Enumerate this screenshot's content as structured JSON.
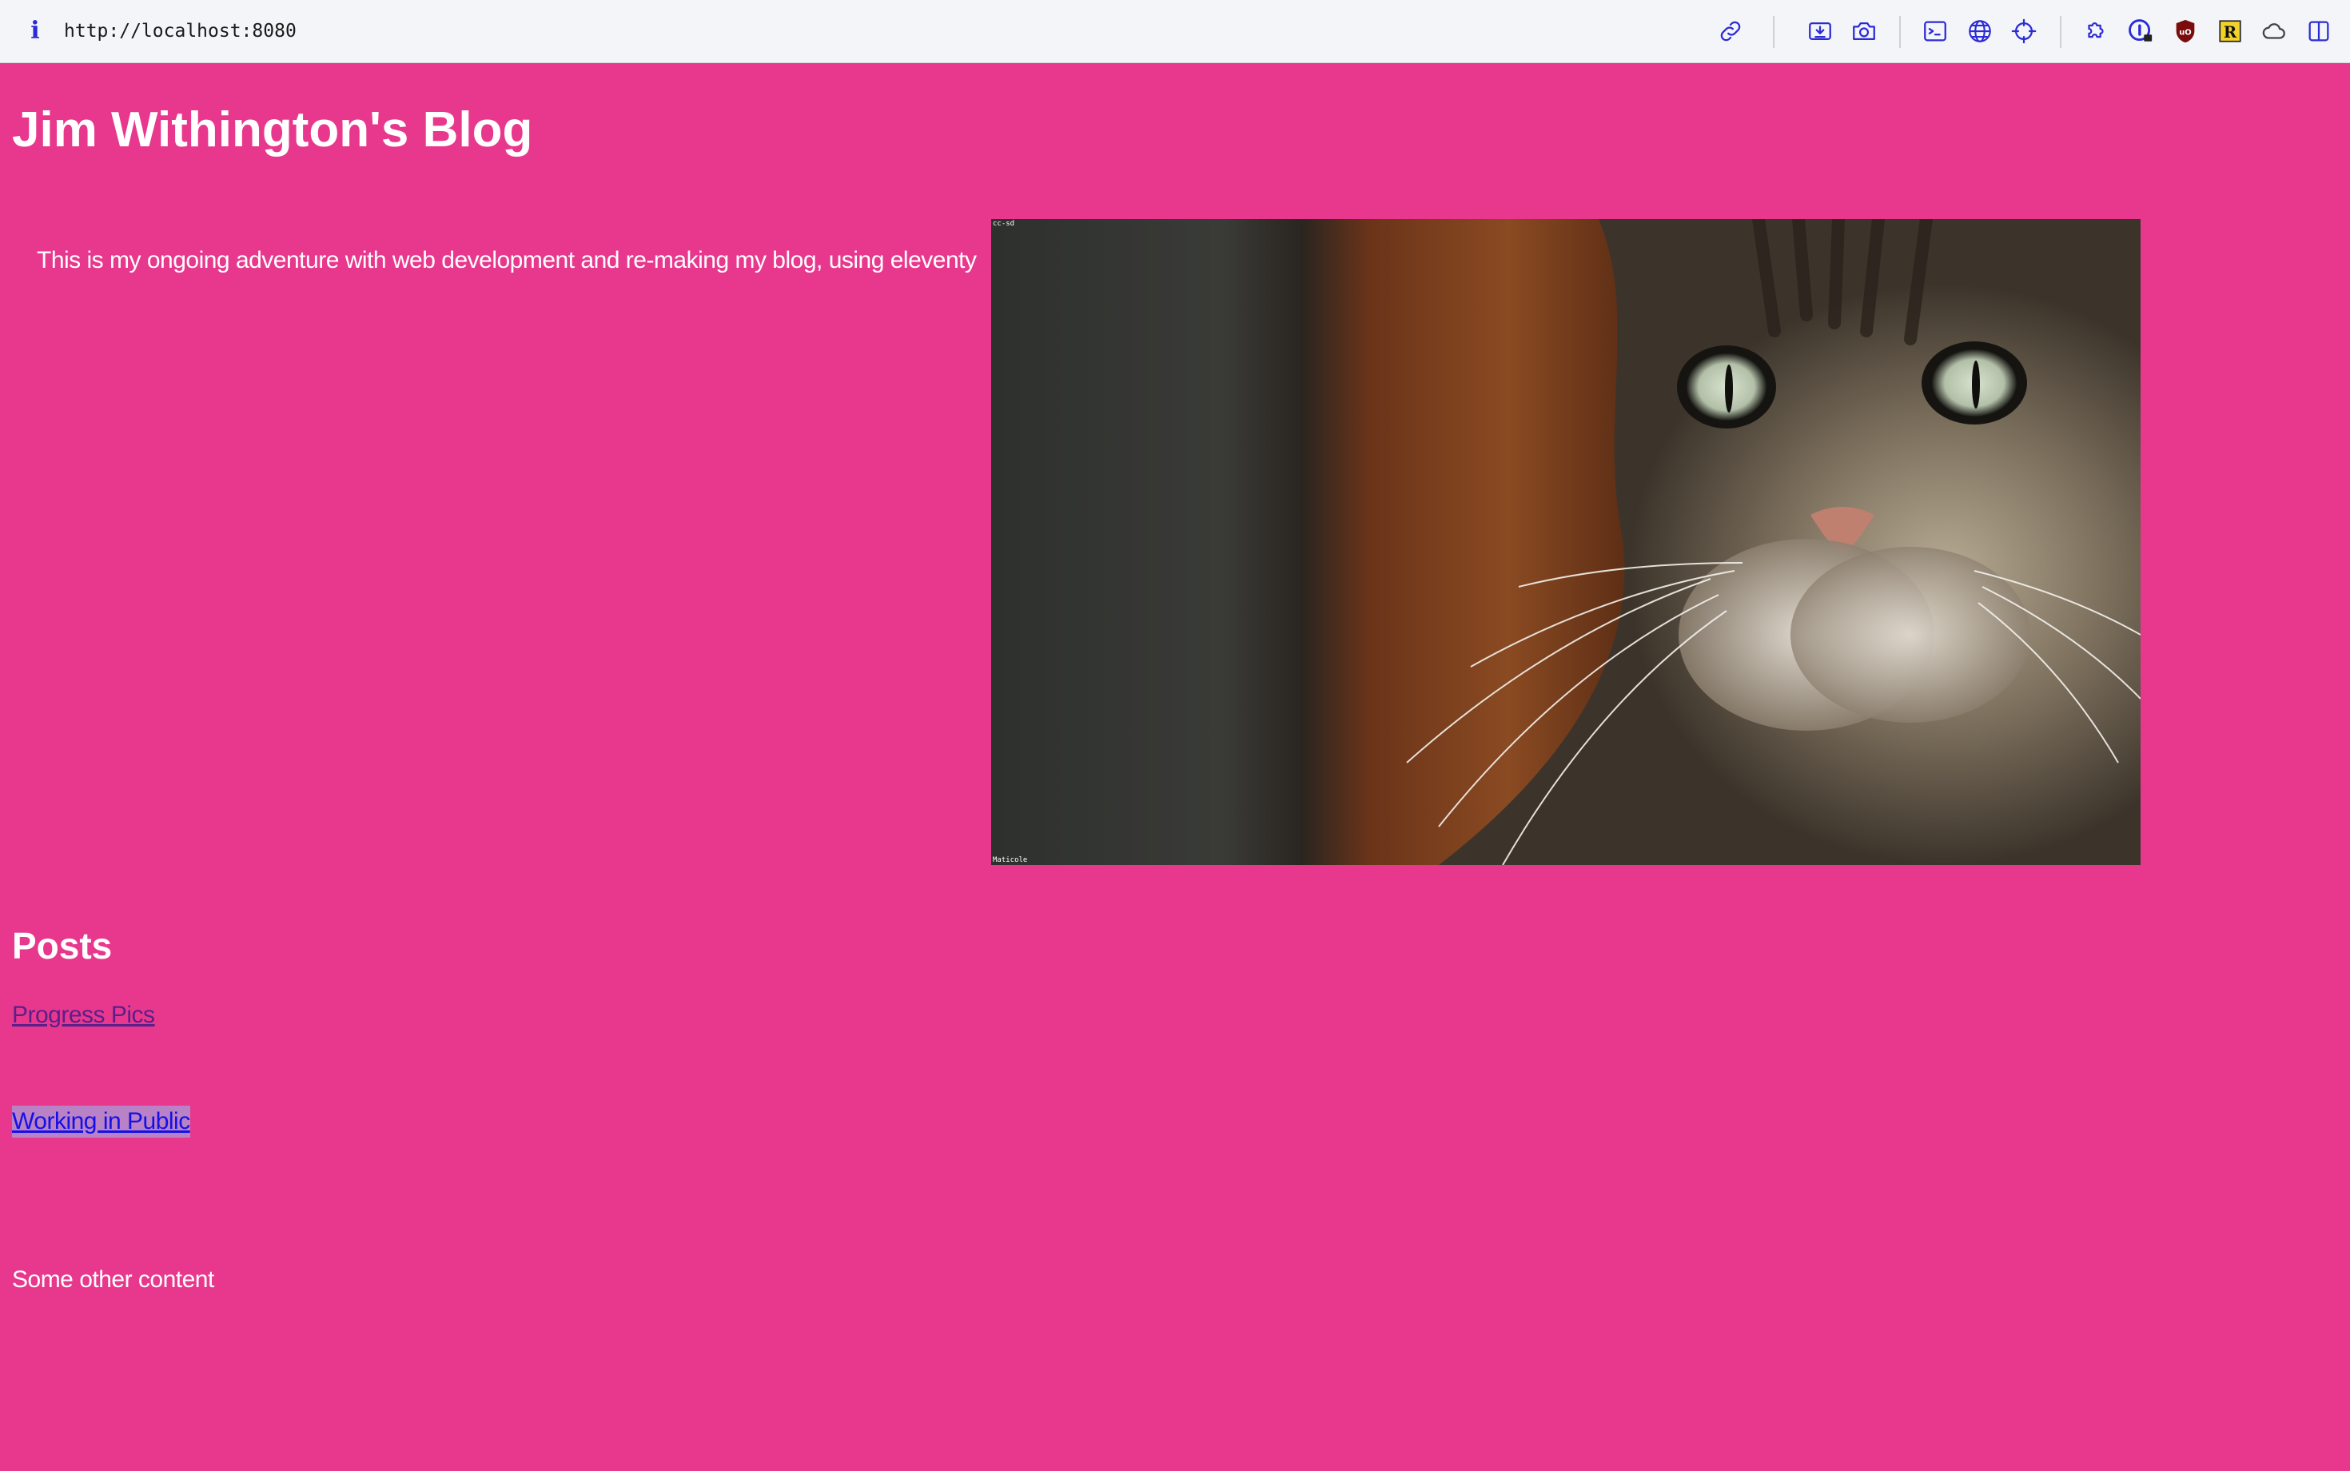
{
  "browser": {
    "info_icon": "i",
    "url": "http://localhost:8080",
    "toolbar_icons": [
      "link-icon",
      "download-icon",
      "camera-icon",
      "terminal-icon",
      "globe-icon",
      "crosshair-icon",
      "extensions-icon",
      "1password-icon",
      "ublock-icon",
      "readwise-icon",
      "cloud-icon",
      "sidebar-icon"
    ]
  },
  "site": {
    "title": "Jim Withington's Blog",
    "intro": "This is my ongoing adventure with web development and re-making my blog, using eleventy"
  },
  "hero": {
    "caption_top": "cc-sd",
    "caption_bottom": "Maticole"
  },
  "posts": {
    "heading": "Posts",
    "items": [
      {
        "label": "Progress Pics"
      },
      {
        "label": "Working in Public"
      }
    ]
  },
  "footer": {
    "text": "Some other content"
  },
  "colors": {
    "page_background": "#e8388e",
    "toolbar_background": "#f4f5f9",
    "link": "#1410e6",
    "visited_link": "#5a1f8a",
    "icon_accent": "#2b2bd6"
  }
}
